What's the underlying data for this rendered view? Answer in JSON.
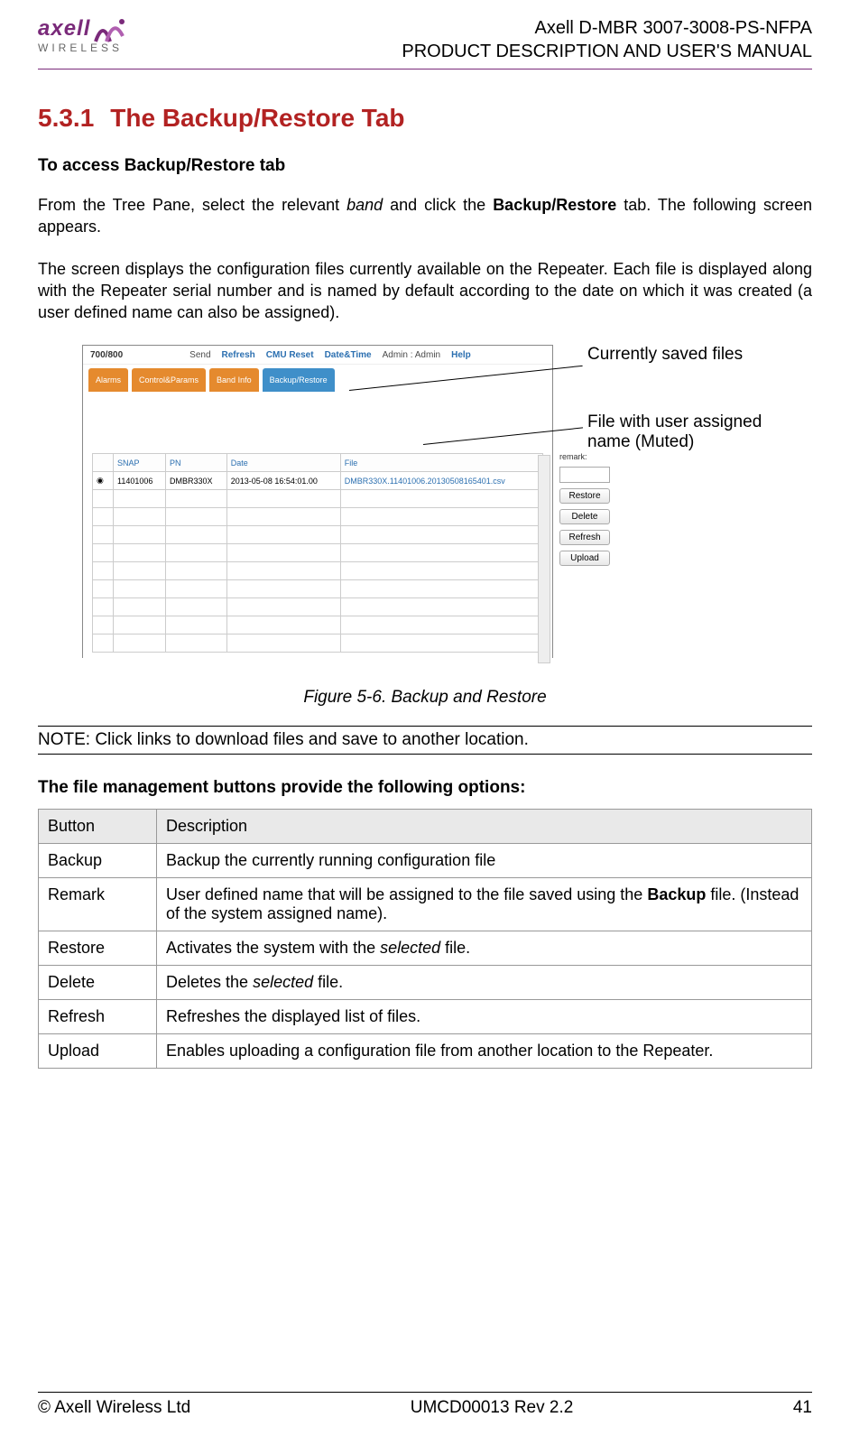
{
  "header": {
    "logo_brand": "axell",
    "logo_sub": "WIRELESS",
    "title_line1": "Axell D-MBR 3007-3008-PS-NFPA",
    "title_line2": "PRODUCT DESCRIPTION AND USER'S MANUAL"
  },
  "section": {
    "number": "5.3.1",
    "title": "The Backup/Restore Tab",
    "access_heading": "To access Backup/Restore tab",
    "para1_a": "From the Tree Pane, select the relevant ",
    "para1_band": "band",
    "para1_b": " and click the ",
    "para1_bold": "Backup/Restore",
    "para1_c": " tab. The following screen appears.",
    "para2": "The screen displays the configuration files currently available on the Repeater. Each file is displayed along with the Repeater serial number and is named by default according to the date on which it was created (a user defined name can also be assigned)."
  },
  "screenshot": {
    "band_label": "700/800",
    "toolbar": {
      "send": "Send",
      "refresh": "Refresh",
      "cmu": "CMU Reset",
      "dt": "Date&Time",
      "admin": "Admin : Admin",
      "help": "Help"
    },
    "tabs": {
      "alarms": "Alarms",
      "control": "Control&Params",
      "bandinfo": "Band Info",
      "backup": "Backup/Restore"
    },
    "cols": {
      "snap": "SNAP",
      "pn": "PN",
      "date": "Date",
      "file": "File"
    },
    "row": {
      "snap": "11401006",
      "pn": "DMBR330X",
      "date": "2013-05-08 16:54:01.00",
      "file": "DMBR330X.11401006.20130508165401.csv"
    },
    "side": {
      "remark": "remark:",
      "restore": "Restore",
      "delete": "Delete",
      "refresh": "Refresh",
      "upload": "Upload"
    },
    "annot1": "Currently saved files",
    "annot2": "File with user assigned name (Muted)"
  },
  "figure_caption": "Figure 5-6. Backup and Restore",
  "note": "NOTE: Click links to download files and save to another location.",
  "options_heading": "The file management buttons provide the following options:",
  "options_table": {
    "head_button": "Button",
    "head_desc": "Description",
    "rows": [
      {
        "btn": "Backup",
        "desc_a": "Backup the currently running configuration file",
        "desc_b": "",
        "bold": "",
        "ital": ""
      },
      {
        "btn": "Remark",
        "desc_a": "User defined name that will be assigned to the file saved using the ",
        "bold": "Backup",
        "desc_b": " file. (Instead of the system assigned name).",
        "ital": ""
      },
      {
        "btn": "Restore",
        "desc_a": "Activates the system with the ",
        "ital": "selected",
        "desc_b": " file.",
        "bold": ""
      },
      {
        "btn": "Delete",
        "desc_a": "Deletes the ",
        "ital": "selected",
        "desc_b": " file.",
        "bold": ""
      },
      {
        "btn": "Refresh",
        "desc_a": "Refreshes the displayed list of files.",
        "desc_b": "",
        "bold": "",
        "ital": ""
      },
      {
        "btn": "Upload",
        "desc_a": "Enables uploading a configuration file from another location to the Repeater.",
        "desc_b": "",
        "bold": "",
        "ital": ""
      }
    ]
  },
  "footer": {
    "left": "© Axell Wireless Ltd",
    "center": "UMCD00013 Rev 2.2",
    "right": "41"
  }
}
